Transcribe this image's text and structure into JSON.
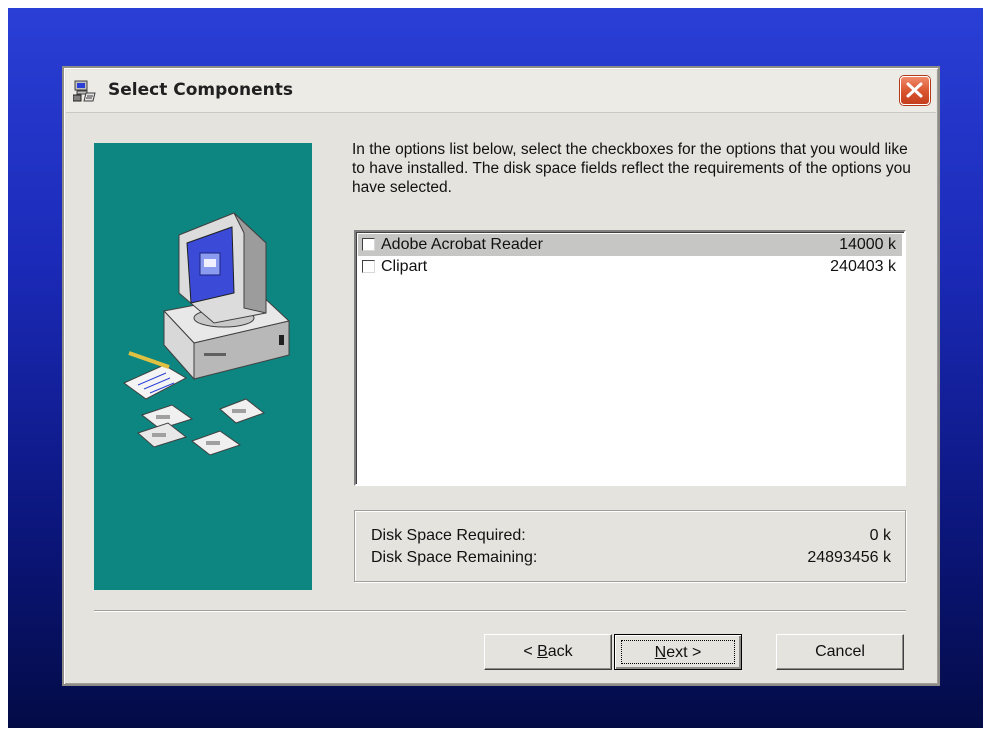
{
  "window": {
    "title": "Select Components",
    "icon": "installer-computer-icon",
    "close_icon": "close-icon",
    "close_color": "#d9532d"
  },
  "instructions": "In the options list below, select the checkboxes for the options that you would like to have installed.  The disk space fields reflect the requirements of the options you have selected.",
  "options": [
    {
      "label": "Adobe Acrobat Reader",
      "size": "14000 k",
      "checked": false,
      "selected": true
    },
    {
      "label": "Clipart",
      "size": "240403 k",
      "checked": false,
      "selected": false
    }
  ],
  "disk": {
    "required_label": "Disk Space Required:",
    "required_value": "0 k",
    "remaining_label": "Disk Space Remaining:",
    "remaining_value": "24893456 k"
  },
  "buttons": {
    "back": "< Back",
    "back_mnemonic": "B",
    "next": "Next >",
    "next_mnemonic": "N",
    "cancel": "Cancel"
  },
  "colors": {
    "desktop_top": "#2a3fd6",
    "desktop_bottom": "#030b46",
    "side_panel": "#0d8681",
    "dialog_face": "#e4e3dd",
    "selection": "#c6c6c4"
  }
}
